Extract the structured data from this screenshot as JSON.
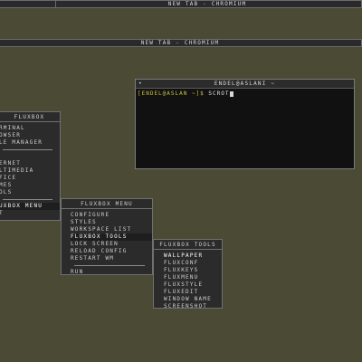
{
  "window_top": {
    "title": "New Tab - Chromium"
  },
  "window_second": {
    "title": "New Tab - Chromium"
  },
  "terminal": {
    "title": "endel@aslani ~",
    "title_icon": "•",
    "prompt": "[endel@aslan ~]$",
    "command": "scrot"
  },
  "root_menu": {
    "title": "Fluxbox",
    "items": [
      "rminal",
      "owser",
      "le Manager",
      "",
      "ernet",
      "ltimedia",
      "fice",
      "mes",
      "ols",
      "",
      "uxbox Menu",
      "t"
    ]
  },
  "fluxbox_menu": {
    "title": "Fluxbox Menu",
    "items": [
      "Configure",
      "Styles",
      "Workspace List",
      "Fluxbox Tools",
      "Lock Screen",
      "Reload Config",
      "Restart WM"
    ],
    "run": "Run"
  },
  "tools_menu": {
    "title": "Fluxbox Tools",
    "items": [
      "Wallpaper",
      "Fluxconf",
      "Fluxkeys",
      "Fluxmenu",
      "Fluxstyle",
      "Fluxedit",
      "Window Name",
      "Screenshot"
    ]
  },
  "colors": {
    "desktop": "#4a4a35",
    "menu_bg": "#2b2b2b",
    "terminal_bg": "#111111",
    "prompt": "#c9c23a"
  }
}
